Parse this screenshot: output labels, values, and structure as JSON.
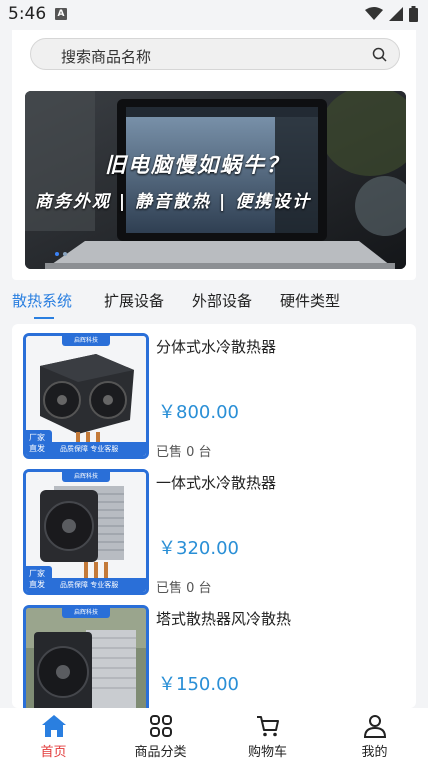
{
  "status_bar": {
    "time": "5:46",
    "app_icon_letter": "A"
  },
  "search": {
    "placeholder": "搜索商品名称",
    "icon": "search-icon"
  },
  "banner": {
    "title": "旧电脑慢如蜗牛？",
    "subtitle": "商务外观 | 静音散热 | 便携设计"
  },
  "tabs": [
    {
      "label": "散热系统",
      "active": true
    },
    {
      "label": "扩展设备",
      "active": false
    },
    {
      "label": "外部设备",
      "active": false
    },
    {
      "label": "硬件类型",
      "active": false
    }
  ],
  "products": [
    {
      "name": "分体式水冷散热器",
      "price": "￥800.00",
      "sold": "已售 0 台",
      "thumb_top": "启辉科技",
      "thumb_bar": "品质保障  专业客服",
      "thumb_badge": "厂家直发"
    },
    {
      "name": "一体式水冷散热器",
      "price": "￥320.00",
      "sold": "已售 0 台",
      "thumb_top": "启辉科技",
      "thumb_bar": "品质保障  专业客服",
      "thumb_badge": "厂家直发"
    },
    {
      "name": "塔式散热器风冷散热",
      "price": "￥150.00",
      "sold": "",
      "thumb_top": "启辉科技",
      "thumb_bar": "",
      "thumb_badge": ""
    }
  ],
  "bottom_nav": [
    {
      "label": "首页",
      "icon": "home-icon",
      "active": true
    },
    {
      "label": "商品分类",
      "icon": "category-grid-icon",
      "active": false
    },
    {
      "label": "购物车",
      "icon": "cart-icon",
      "active": false
    },
    {
      "label": "我的",
      "icon": "user-icon",
      "active": false
    }
  ],
  "colors": {
    "accent": "#2a7fe0",
    "price": "#2a8fd6",
    "nav_active": "#e23b3b"
  }
}
